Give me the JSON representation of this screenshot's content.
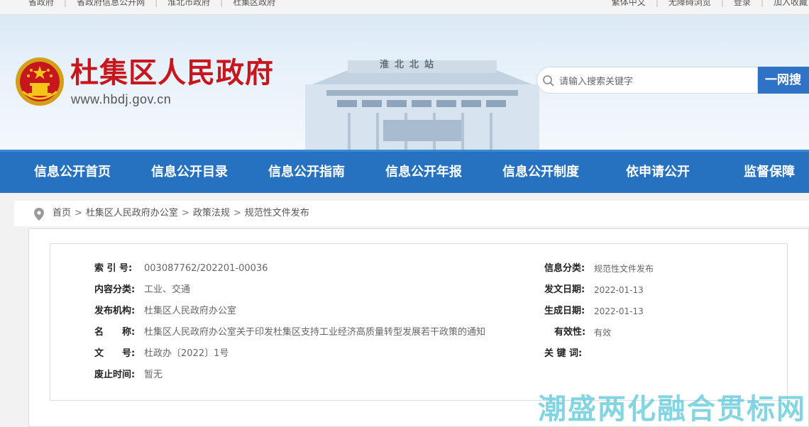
{
  "topbar": {
    "left_links": [
      "省政府",
      "省政府信息公开网",
      "淮北市政府",
      "杜集区政府"
    ],
    "right_links": [
      "繁体中文",
      "无障碍浏览",
      "登录",
      "加入收藏"
    ]
  },
  "header": {
    "site_name": "杜集区人民政府",
    "site_url": "www.hbdj.gov.cn",
    "station_sign": "淮北北站"
  },
  "search": {
    "placeholder": "请输入搜索关键字",
    "button_label": "一网搜"
  },
  "nav": {
    "items": [
      "信息公开首页",
      "信息公开目录",
      "信息公开指南",
      "信息公开年报",
      "信息公开制度",
      "依申请公开",
      "监督保障"
    ]
  },
  "breadcrumb": {
    "items": [
      "首页",
      "杜集区人民政府办公室",
      "政策法规",
      "规范性文件发布"
    ],
    "separator": ">"
  },
  "meta": {
    "left": [
      {
        "label": "索 引 号:",
        "value": "003087762/202201-00036"
      },
      {
        "label": "内容分类:",
        "value": "工业、交通"
      },
      {
        "label": "发布机构:",
        "value": "杜集区人民政府办公室"
      },
      {
        "label": "名　　称:",
        "value": "杜集区人民政府办公室关于印发杜集区支持工业经济高质量转型发展若干政策的通知"
      },
      {
        "label": "文　　号:",
        "value": "杜政办〔2022〕1号"
      },
      {
        "label": "废止时间:",
        "value": "暂无"
      }
    ],
    "right": [
      {
        "label": "信息分类:",
        "value": "规范性文件发布"
      },
      {
        "label": "发文日期:",
        "value": "2022-01-13"
      },
      {
        "label": "生成日期:",
        "value": "2022-01-13"
      },
      {
        "label": "有效性:",
        "value": "有效"
      },
      {
        "label": "关 键 词:",
        "value": ""
      }
    ]
  },
  "watermark": "潮盛两化融合贯标网",
  "colors": {
    "brand_red": "#c8161d",
    "nav_blue": "#2672c1",
    "search_blue": "#2f73c7"
  }
}
